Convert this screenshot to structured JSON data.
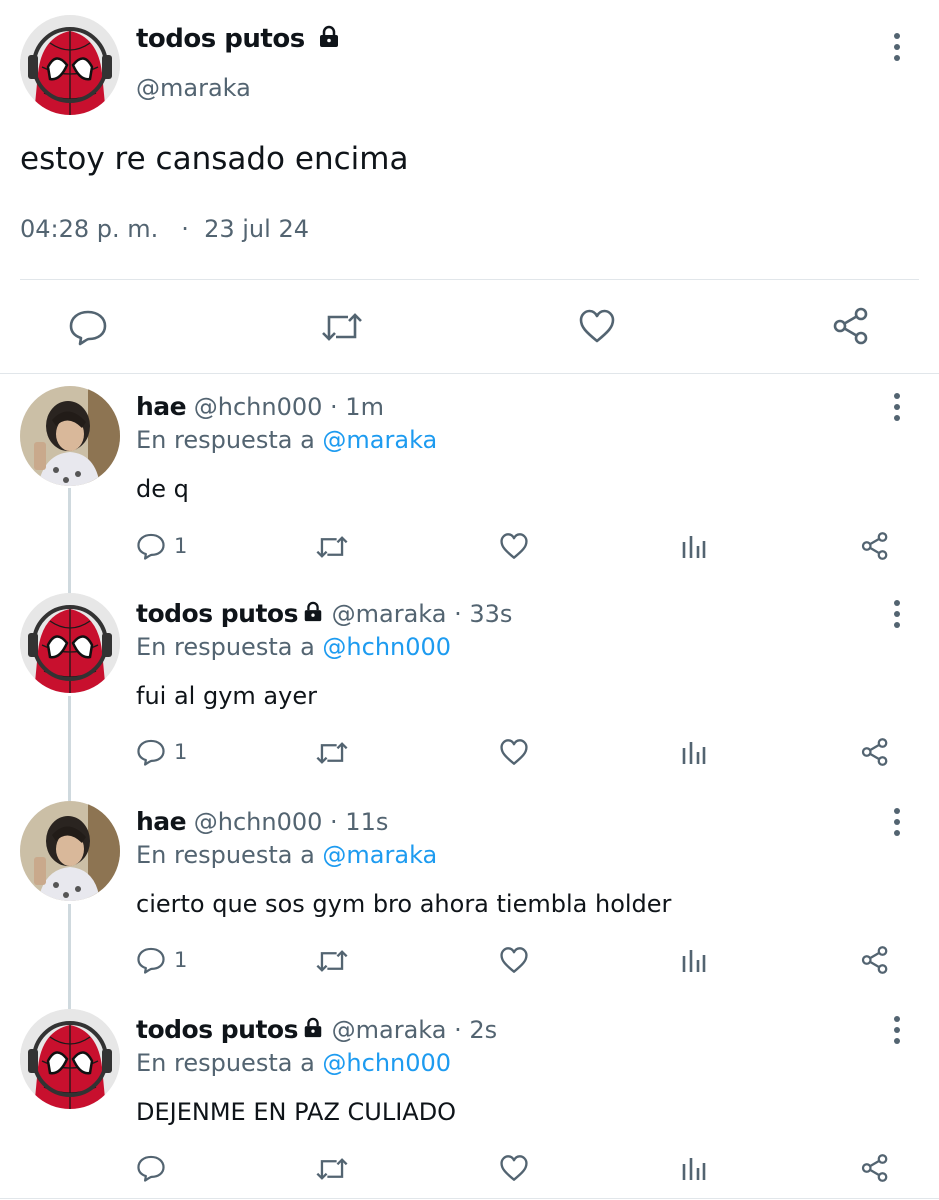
{
  "main_tweet": {
    "display_name": "todos putos",
    "handle": "@maraka",
    "text": "estoy re cansado encima",
    "time": "04:28 p. m.",
    "separator": "·",
    "date": "23 jul 24",
    "icons": [
      "reply-icon",
      "retweet-icon",
      "like-icon",
      "share-icon",
      "more-icon",
      "lock-icon"
    ]
  },
  "replies": [
    {
      "display_name": "hae",
      "handle": "@hchn000",
      "time": "· 1m",
      "reply_prefix": "En respuesta a",
      "reply_to": "@maraka",
      "text": "de q",
      "reply_count": "1",
      "protected": false
    },
    {
      "display_name": "todos putos",
      "handle": "@maraka",
      "time": "· 33s",
      "reply_prefix": "En respuesta a",
      "reply_to": "@hchn000",
      "text": "fui al gym ayer",
      "reply_count": "1",
      "protected": true
    },
    {
      "display_name": "hae",
      "handle": "@hchn000",
      "time": "· 11s",
      "reply_prefix": "En respuesta a",
      "reply_to": "@maraka",
      "text": "cierto que sos gym bro ahora tiembla holder",
      "reply_count": "1",
      "protected": false
    },
    {
      "display_name": "todos putos",
      "handle": "@maraka",
      "time": "· 2s",
      "reply_prefix": "En respuesta a",
      "reply_to": "@hchn000",
      "text": "DEJENME EN PAZ CULIADO",
      "reply_count": "",
      "protected": true
    }
  ],
  "colors": {
    "text": "#0f1419",
    "secondary": "#536471",
    "link": "#1d9bf0",
    "divider": "#e1e6ea"
  }
}
